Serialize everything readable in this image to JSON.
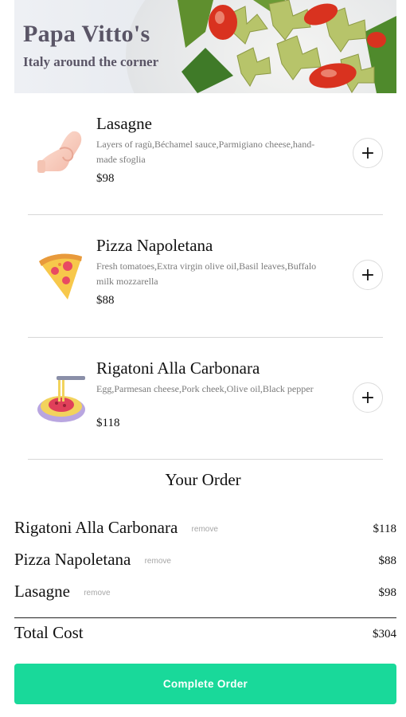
{
  "header": {
    "title": "Papa Vitto's",
    "subtitle": "Italy around the corner"
  },
  "menu": {
    "items": [
      {
        "name": "Lasagne",
        "description": "Layers of ragù,Béchamel sauce,Parmigiano cheese,hand-made sfoglia",
        "price": "$98",
        "icon": "pinched-fingers-icon",
        "add_label": "+"
      },
      {
        "name": "Pizza Napoletana",
        "description": "Fresh tomatoes,Extra virgin olive oil,Basil leaves,Buffalo milk mozzarella",
        "price": "$88",
        "icon": "pizza-slice-icon",
        "add_label": "+"
      },
      {
        "name": "Rigatoni Alla Carbonara",
        "description": "Egg,Parmesan cheese,Pork cheek,Olive oil,Black pepper",
        "price": "$118",
        "icon": "spaghetti-plate-icon",
        "add_label": "+"
      }
    ]
  },
  "order": {
    "title": "Your Order",
    "items": [
      {
        "name": "Rigatoni Alla Carbonara",
        "remove_label": "remove",
        "price": "$118"
      },
      {
        "name": "Pizza Napoletana",
        "remove_label": "remove",
        "price": "$88"
      },
      {
        "name": "Lasagne",
        "remove_label": "remove",
        "price": "$98"
      }
    ],
    "total_label": "Total Cost",
    "total_value": "$304",
    "complete_label": "Complete Order"
  },
  "colors": {
    "accent": "#19d99a",
    "title_text": "#5a5566",
    "muted_text": "#7a7a7a"
  }
}
